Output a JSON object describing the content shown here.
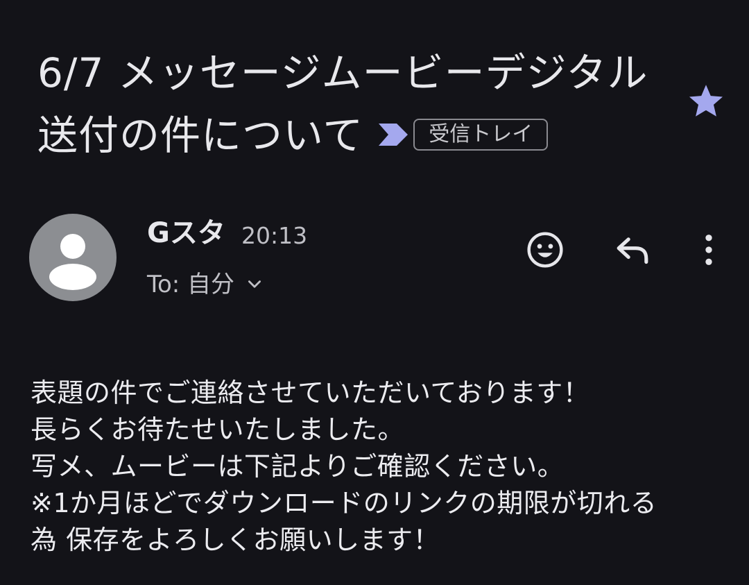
{
  "email": {
    "subject_line1": "6/7 メッセージムービーデジタル",
    "subject_line2": "送付の件について",
    "label": "受信トレイ",
    "starred": true,
    "star_color": "#a4a8ee",
    "importance_color": "#a4a8ee",
    "sender_name": "Gスタ",
    "time": "20:13",
    "recipient": "To: 自分",
    "body_lines": [
      "表題の件でご連絡させていただいております！",
      "長らくお待たせいたしました。",
      "写メ、ムービーは下記よりご確認ください。",
      "※1か月ほどでダウンロードのリンクの期限が切れる",
      "為 保存をよろしくお願いします！"
    ]
  },
  "icons": {
    "star": "star-icon",
    "importance": "importance-marker-icon",
    "avatar": "person-icon",
    "recipient_expand": "chevron-down-icon",
    "emoji": "emoji-reaction-icon",
    "reply": "reply-icon",
    "more": "more-vertical-icon"
  }
}
